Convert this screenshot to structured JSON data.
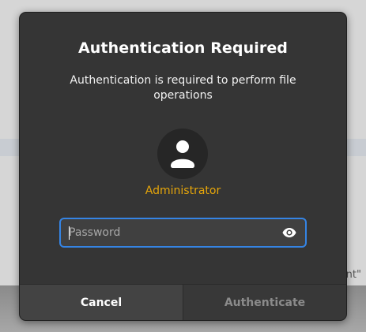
{
  "background": {
    "partial_text": "mnt\""
  },
  "dialog": {
    "title": "Authentication Required",
    "message": "Authentication is required to perform file operations",
    "user": {
      "name": "Administrator",
      "avatar_icon": "user-avatar-icon"
    },
    "password": {
      "placeholder": "Password",
      "value": "",
      "reveal_icon": "eye-icon"
    },
    "buttons": {
      "cancel_label": "Cancel",
      "authenticate_label": "Authenticate"
    },
    "colors": {
      "accent": "#3584e4",
      "username": "#e5a50a",
      "dialog_bg": "#353535"
    }
  }
}
